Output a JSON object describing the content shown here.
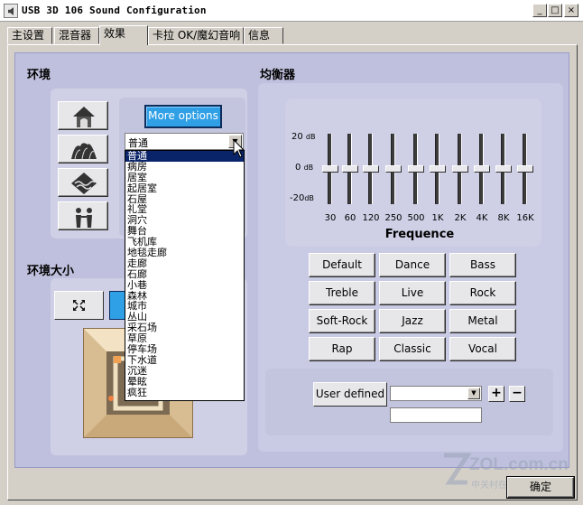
{
  "window": {
    "title": "USB 3D 106 Sound Configuration",
    "minimize": "_",
    "maximize": "□",
    "close": "×"
  },
  "tabs": [
    {
      "label": "主设置"
    },
    {
      "label": "混音器"
    },
    {
      "label": "效果"
    },
    {
      "label": "卡拉 OK/魔幻音响"
    },
    {
      "label": "信息"
    }
  ],
  "environment": {
    "title": "环境",
    "more_options": "More options",
    "buttons": [
      {
        "icon": "house-icon"
      },
      {
        "icon": "opera-house-icon"
      },
      {
        "icon": "landscape-icon"
      },
      {
        "icon": "people-icon"
      }
    ],
    "selected": "普通",
    "options": [
      "普通",
      "病房",
      "居室",
      "起居室",
      "石屋",
      "礼堂",
      "洞穴",
      "舞台",
      "飞机库",
      "地毯走廊",
      "走廊",
      "石廊",
      "小巷",
      "森林",
      "城市",
      "丛山",
      "采石场",
      "草原",
      "停车场",
      "下水道",
      "沉迷",
      "晕眩",
      "疯狂"
    ]
  },
  "env_size": {
    "title": "环境大小"
  },
  "equalizer": {
    "title": "均衡器",
    "db_labels": [
      "20",
      "0",
      "-20"
    ],
    "db_unit": "dB",
    "frequencies": [
      "30",
      "60",
      "120",
      "250",
      "500",
      "1K",
      "2K",
      "4K",
      "8K",
      "16K"
    ],
    "gains_db": [
      0,
      0,
      0,
      0,
      0,
      0,
      0,
      0,
      0,
      0
    ],
    "frequence_label": "Frequence",
    "presets": [
      "Default",
      "Dance",
      "Bass",
      "Treble",
      "Live",
      "Rock",
      "Soft-Rock",
      "Jazz",
      "Metal",
      "Rap",
      "Classic",
      "Vocal"
    ],
    "user_defined": "User defined",
    "plus": "+",
    "minus": "−"
  },
  "ok_button": "确定",
  "watermark": {
    "brand": "ZOL.com.cn",
    "sub": "中关村在线"
  }
}
